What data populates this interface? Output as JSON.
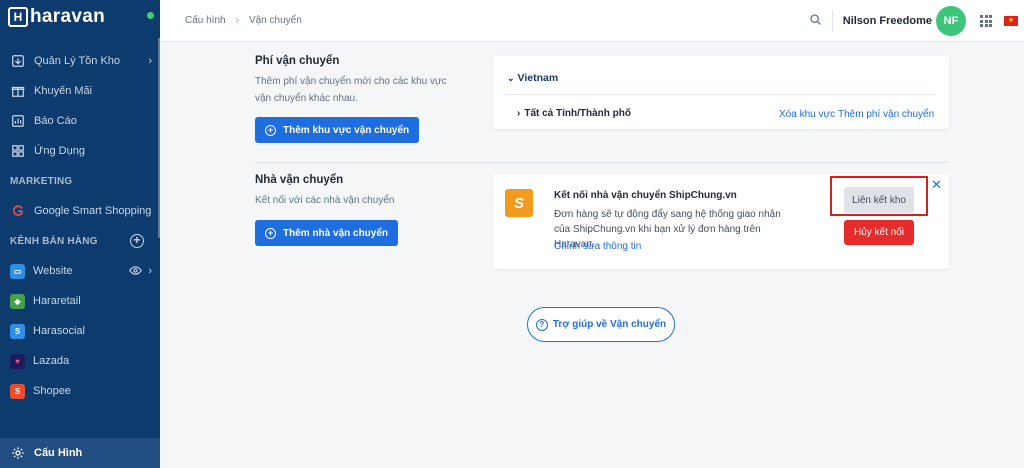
{
  "sidebar": {
    "logo": "haravan",
    "items": [
      {
        "label": "Quản Lý Tồn Kho",
        "icon": "inventory-icon"
      },
      {
        "label": "Khuyến Mãi",
        "icon": "promotion-icon"
      },
      {
        "label": "Báo Cáo",
        "icon": "report-icon"
      },
      {
        "label": "Ứng Dụng",
        "icon": "apps-icon"
      }
    ],
    "marketing_label": "MARKETING",
    "marketing_items": [
      {
        "label": "Google Smart Shopping",
        "icon": "google-icon"
      }
    ],
    "channels_label": "KÊNH BÁN HÀNG",
    "channels": [
      {
        "label": "Website",
        "color": "#2d8fe5"
      },
      {
        "label": "Hararetail",
        "color": "#44a04a"
      },
      {
        "label": "Harasocial",
        "color": "#2d8fe5"
      },
      {
        "label": "Lazada",
        "color": "#1b1b5e"
      },
      {
        "label": "Shopee",
        "color": "#ee4d2d"
      }
    ],
    "settings_label": "Cấu Hình"
  },
  "topbar": {
    "breadcrumb": [
      "Cấu hình",
      "Vận chuyển"
    ],
    "user_name": "Nilson Freedome",
    "avatar_initials": "NF"
  },
  "shipping_fee": {
    "title": "Phí vận chuyển",
    "description": "Thêm phí vận chuyển mới cho các khu vực vận chuyển khác nhau.",
    "add_button": "Thêm khu vực vận chuyển",
    "zone_country": "Vietnam",
    "zone_row": "Tất cả Tỉnh/Thành phố",
    "delete_zone": "Xóa khu vực",
    "add_fee": "Thêm phí vận chuyển"
  },
  "carrier": {
    "title": "Nhà vận chuyển",
    "description": "Kết nối với các nhà vận chuyển",
    "add_button": "Thêm nhà vận chuyển",
    "card_title": "Kết nối nhà vận chuyển ShipChung.vn",
    "card_desc": "Đơn hàng sẽ tự động đẩy sang hệ thống giao nhận của ShipChung.vn khi bạn xử lý đơn hàng trên Haravan.",
    "edit_link": "Chỉnh sửa thông tin",
    "link_warehouse": "Liên kết kho",
    "disconnect": "Hủy kết nối"
  },
  "help": {
    "label": "Trợ giúp về Vận chuyển"
  }
}
